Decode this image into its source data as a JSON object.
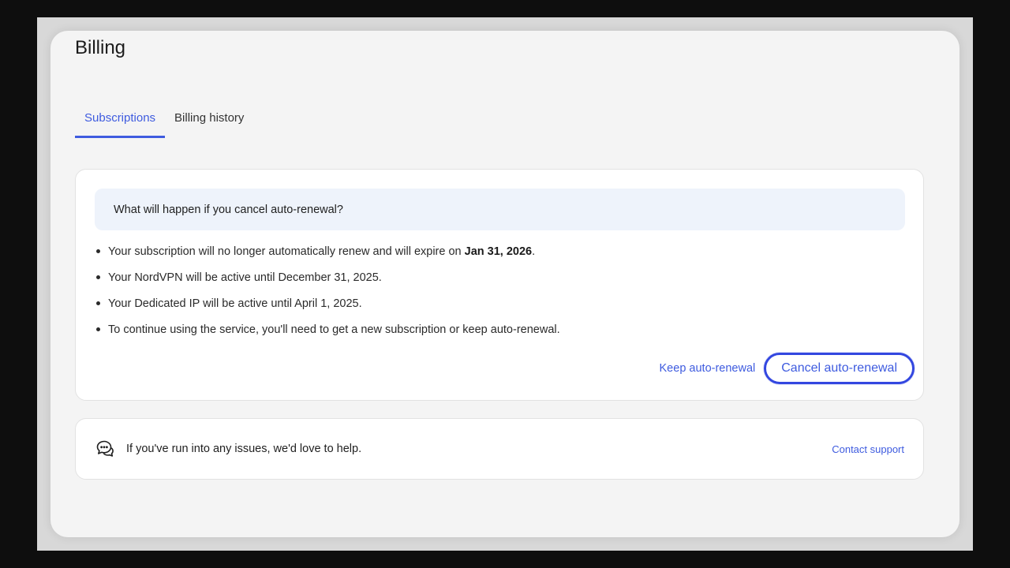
{
  "page": {
    "title": "Billing"
  },
  "tabs": [
    {
      "label": "Subscriptions",
      "active": true
    },
    {
      "label": "Billing history",
      "active": false
    }
  ],
  "cancel_panel": {
    "heading": "What will happen if you cancel auto-renewal?",
    "bullets": {
      "b1_prefix": "Your subscription will no longer automatically renew and will expire on ",
      "b1_date": "Jan 31, 2026",
      "b1_suffix": ".",
      "b2": "Your NordVPN will be active until December 31, 2025.",
      "b3": "Your Dedicated IP will be active until April 1, 2025.",
      "b4": "To continue using the service, you'll need to get a new subscription or keep auto-renewal."
    },
    "keep_label": "Keep auto-renewal",
    "cancel_label": "Cancel auto-renewal"
  },
  "help_panel": {
    "icon": "chat-bubbles-icon",
    "text": "If you've run into any issues, we'd love to help.",
    "contact_label": "Contact support"
  },
  "colors": {
    "accent": "#3e5bdf",
    "focus_ring": "#3347e0",
    "notice_bg": "#eef3fb",
    "page_bg": "#f4f4f4"
  }
}
